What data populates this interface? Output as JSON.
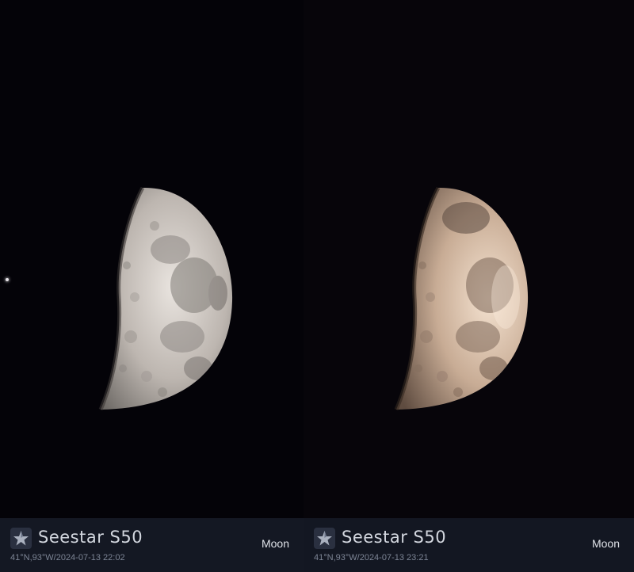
{
  "panels": [
    {
      "brand": "Seestar S50",
      "location_time": "41°N,93°W/2024-07-13 22:02",
      "target": "Moon",
      "icon": "seestar-logo-icon",
      "moon_tone": "#cbc3bd"
    },
    {
      "brand": "Seestar S50",
      "location_time": "41°N,93°W/2024-07-13 23:21",
      "target": "Moon",
      "icon": "seestar-logo-icon",
      "moon_tone": "#d6bfae"
    }
  ],
  "colors": {
    "background": "#030206",
    "info_bar": "#141823",
    "brand_text": "#d3d7df",
    "meta_text": "#7d8595"
  }
}
